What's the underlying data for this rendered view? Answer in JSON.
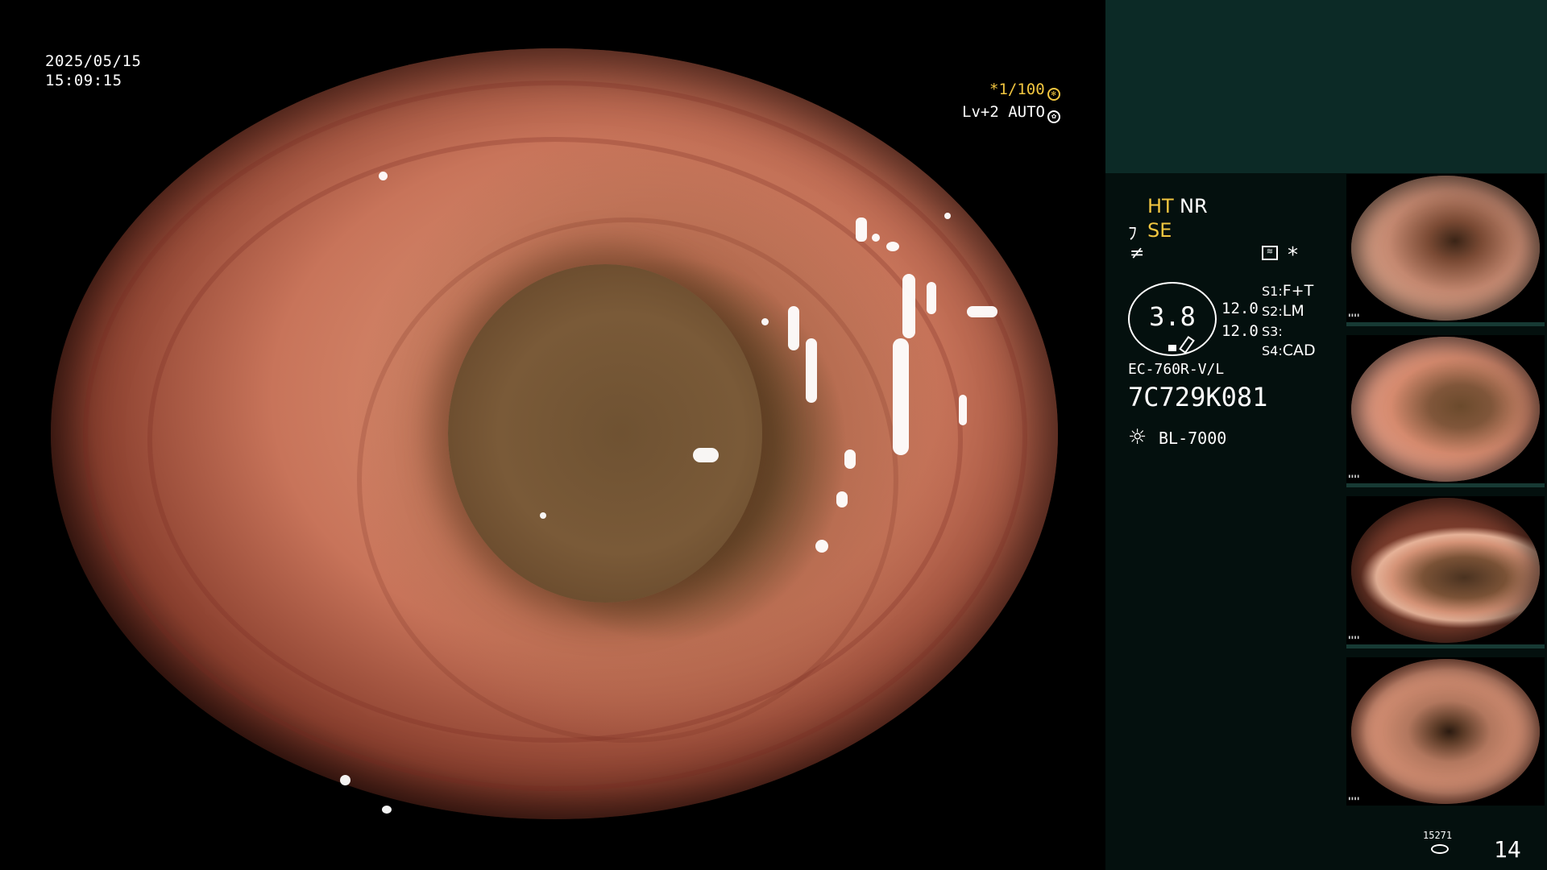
{
  "overlay": {
    "date": "2025/05/15",
    "time": "15:09:15",
    "shutter": "*1/100",
    "level": "Lv+2 AUTO"
  },
  "panel": {
    "ht": "HT",
    "nr": "NR",
    "se": "SE",
    "gauge_value": "3.8",
    "val_a": "12.0",
    "val_b": "12.0",
    "s1_label": "S1:",
    "s1_value": "F+T",
    "s2_label": "S2:",
    "s2_value": "LM",
    "s3_label": "S3:",
    "s3_value": "",
    "s4_label": "S4:",
    "s4_value": "CAD",
    "scope_model": "EC-760R-V/L",
    "scope_serial": "7C729K081",
    "light_source": "BL-7000",
    "asterisk": "*",
    "counter_top": "15271",
    "counter": "14"
  },
  "icons": {
    "shutter": "aperture-icon",
    "level": "iris-icon",
    "se": "structure-enhance-icon",
    "color": "color-mode-icon",
    "chart": "monitor-icon",
    "light": "light-bulb-icon",
    "storage": "disk-icon"
  },
  "thumbnails": [
    {
      "name": "thumbnail-1"
    },
    {
      "name": "thumbnail-2"
    },
    {
      "name": "thumbnail-3"
    },
    {
      "name": "thumbnail-4"
    }
  ]
}
